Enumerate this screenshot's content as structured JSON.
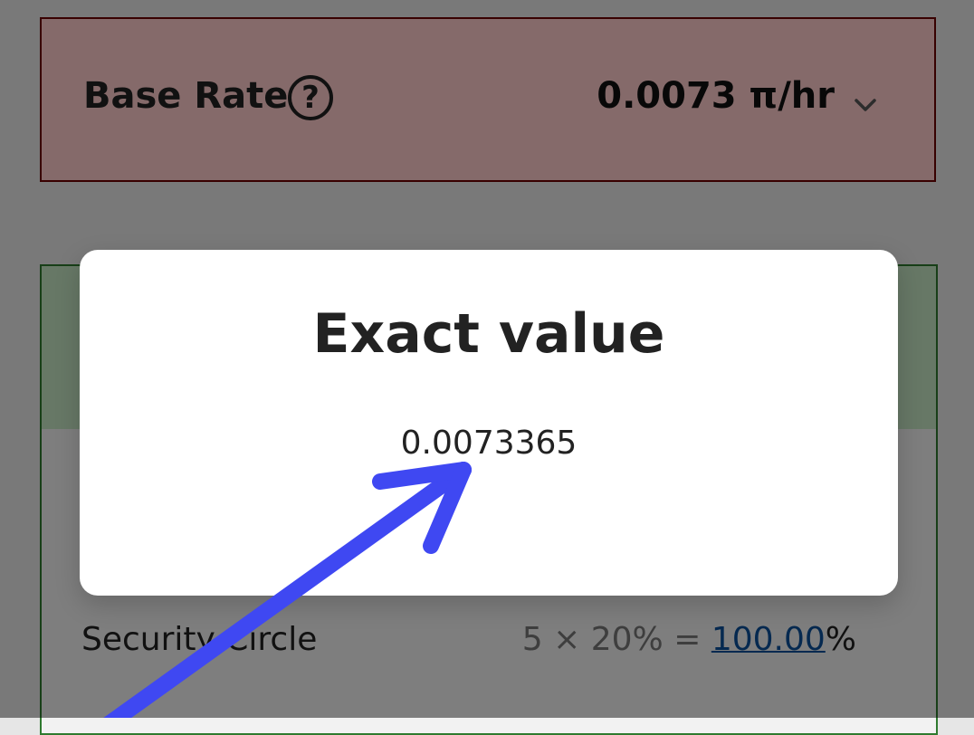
{
  "base_rate": {
    "label": "Base Rate",
    "value": "0.0073 π/hr"
  },
  "security_circle": {
    "label": "Security Circle",
    "formula_prefix": "5 × 20% = ",
    "formula_link": "100.00",
    "formula_suffix": "%"
  },
  "modal": {
    "title": "Exact value",
    "value": "0.0073365"
  },
  "colors": {
    "arrow": "#3f48f2",
    "base_rate_border": "#6b0000",
    "base_rate_fill": "#ffcccc",
    "green_border": "#2f7a2f",
    "green_fill": "#c5e6c3",
    "link": "#0a4f9a"
  },
  "icons": {
    "help": "question-mark-circle-icon",
    "chevron": "chevron-down-icon",
    "annotation": "arrow-annotation"
  }
}
